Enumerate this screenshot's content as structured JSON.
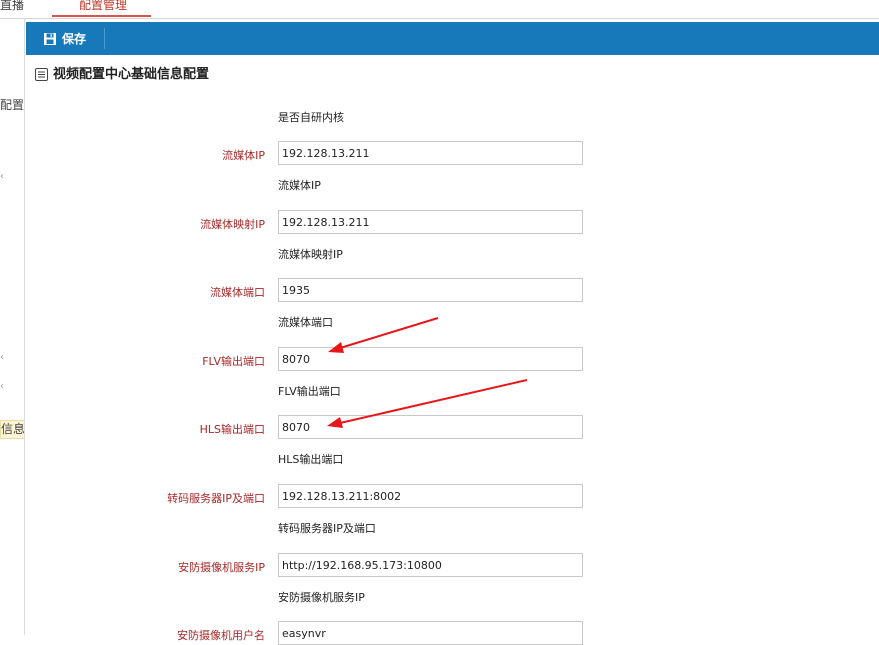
{
  "top_tabs": {
    "left_label": "直播",
    "active_label": "配置管理"
  },
  "sidebar": {
    "item_config": "配置",
    "badge_label": "信息"
  },
  "toolbar": {
    "save_label": "保存",
    "save_icon": "floppy-disk-icon"
  },
  "section": {
    "title": "视频配置中心基础信息配置",
    "icon": "list-icon"
  },
  "form": {
    "top_hint": "是否自研内核",
    "fields": [
      {
        "label": "流媒体IP",
        "value": "192.128.13.211",
        "hint": "流媒体IP"
      },
      {
        "label": "流媒体映射IP",
        "value": "192.128.13.211",
        "hint": "流媒体映射IP"
      },
      {
        "label": "流媒体端口",
        "value": "1935",
        "hint": "流媒体端口"
      },
      {
        "label": "FLV输出端口",
        "value": "8070",
        "hint": "FLV输出端口"
      },
      {
        "label": "HLS输出端口",
        "value": "8070",
        "hint": "HLS输出端口"
      },
      {
        "label": "转码服务器IP及端口",
        "value": "192.128.13.211:8002",
        "hint": "转码服务器IP及端口"
      },
      {
        "label": "安防摄像机服务IP",
        "value": "http://192.168.95.173:10800",
        "hint": "安防摄像机服务IP"
      },
      {
        "label": "安防摄像机用户名",
        "value": "easynvr"
      }
    ]
  },
  "colors": {
    "toolbar_bg": "#1779b9",
    "label_red": "#a82828",
    "arrow_red": "#e8161b",
    "tab_active": "#c0392b"
  }
}
